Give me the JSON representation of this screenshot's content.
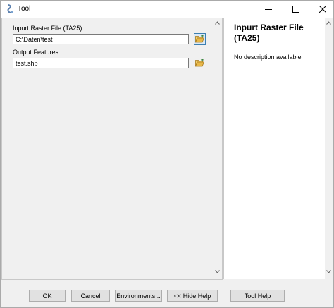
{
  "window": {
    "title": "Tool"
  },
  "form": {
    "input_label": "Inpurt Raster File (TA25)",
    "input_value": "C:\\Daten\\test",
    "output_label": "Output Features",
    "output_value": "test.shp"
  },
  "help": {
    "title": "Inpurt Raster File (TA25)",
    "description": "No description available"
  },
  "buttons": {
    "ok": "OK",
    "cancel": "Cancel",
    "environments": "Environments...",
    "hide_help": "<< Hide Help",
    "tool_help": "Tool Help"
  },
  "icons": {
    "app": "tool-icon",
    "browse": "folder-open-icon"
  },
  "colors": {
    "active_border": "#3c7fb1",
    "folder": "#e8b84a"
  }
}
